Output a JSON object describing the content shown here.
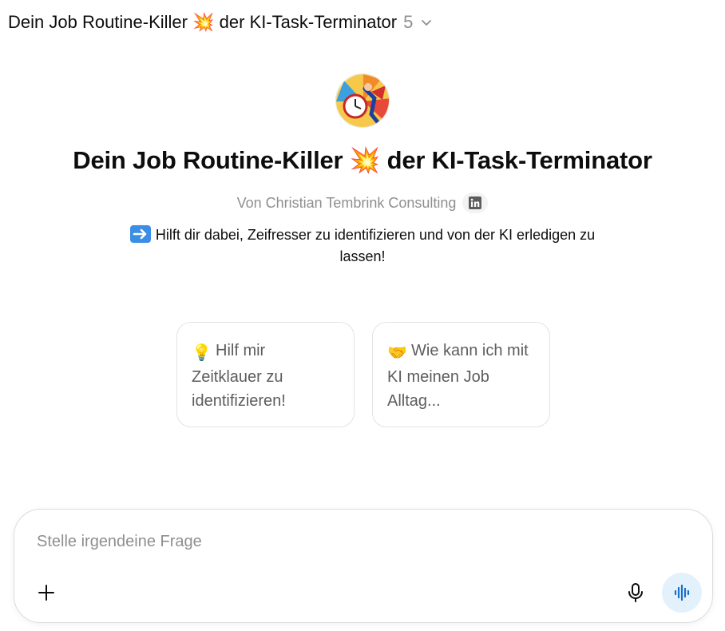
{
  "header": {
    "title": "Dein Job Routine-Killer 💥 der KI-Task-Terminator",
    "version": "5"
  },
  "gpt": {
    "title": "Dein Job Routine-Killer 💥 der KI-Task-Terminator",
    "author": "Von Christian Tembrink Consulting",
    "description": "Hilft dir dabei, Zeifresser zu identifizieren und von der KI erledigen zu lassen!"
  },
  "starters": [
    {
      "emoji": "💡",
      "text": "Hilf mir Zeitklauer zu identifizieren!"
    },
    {
      "emoji": "🤝",
      "text": "Wie kann ich mit KI meinen Job Alltag..."
    }
  ],
  "composer": {
    "placeholder": "Stelle irgendeine Frage"
  },
  "icons": {
    "chevron": "chevron-down-icon",
    "linkedin": "linkedin-icon",
    "plus": "plus-icon",
    "mic": "microphone-icon",
    "voice": "voice-waveform-icon"
  },
  "colors": {
    "voice_button_bg": "#e3f1fd",
    "voice_icon": "#1a6fc9"
  }
}
